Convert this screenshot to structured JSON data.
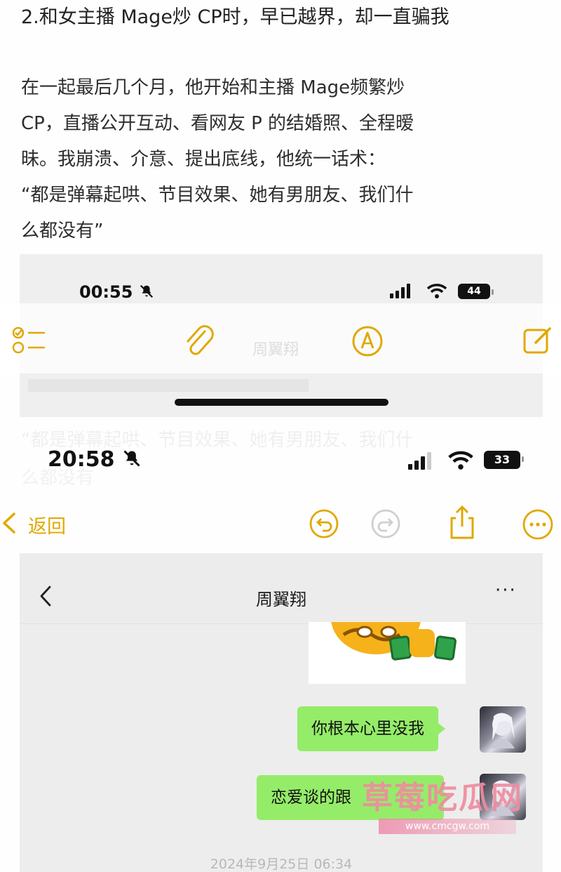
{
  "article": {
    "heading": "2.和女主播 Mage炒 CP时，早已越界，却一直骗我",
    "paragraph_lines": [
      "在一起最后几个月，他开始和主播 Mage频繁炒",
      " CP，直播公开互动、看网友 P 的结婚照、全程暧",
      "昧。我崩溃、介意、提出底线，他统一话术：",
      "“都是弹幕起哄、节目效果、她有男朋友、我们什",
      "么都没有”"
    ]
  },
  "screenshot1": {
    "status_time": "00:55",
    "battery": "44",
    "toolbar_icons": [
      "checklist-icon",
      "paperclip-icon",
      "markup-pen-icon",
      "compose-icon"
    ]
  },
  "screenshot2": {
    "status_time": "20:58",
    "battery": "33",
    "back_label": "返回",
    "toolbar_icons": [
      "undo-icon",
      "redo-icon",
      "share-icon",
      "more-circle-icon"
    ],
    "chat": {
      "contact_name": "周翼翔",
      "more": "···",
      "messages": [
        {
          "text": "你根本心里没我"
        },
        {
          "text": "恋爱谈的跟"
        }
      ],
      "timestamp": "2024年9月25日 06:34"
    }
  },
  "watermark": {
    "text": "草莓吃瓜网",
    "url": "www.cmcgw.com"
  },
  "colors": {
    "accent_yellow": "#e0a800",
    "bubble_green": "#95ec69"
  }
}
